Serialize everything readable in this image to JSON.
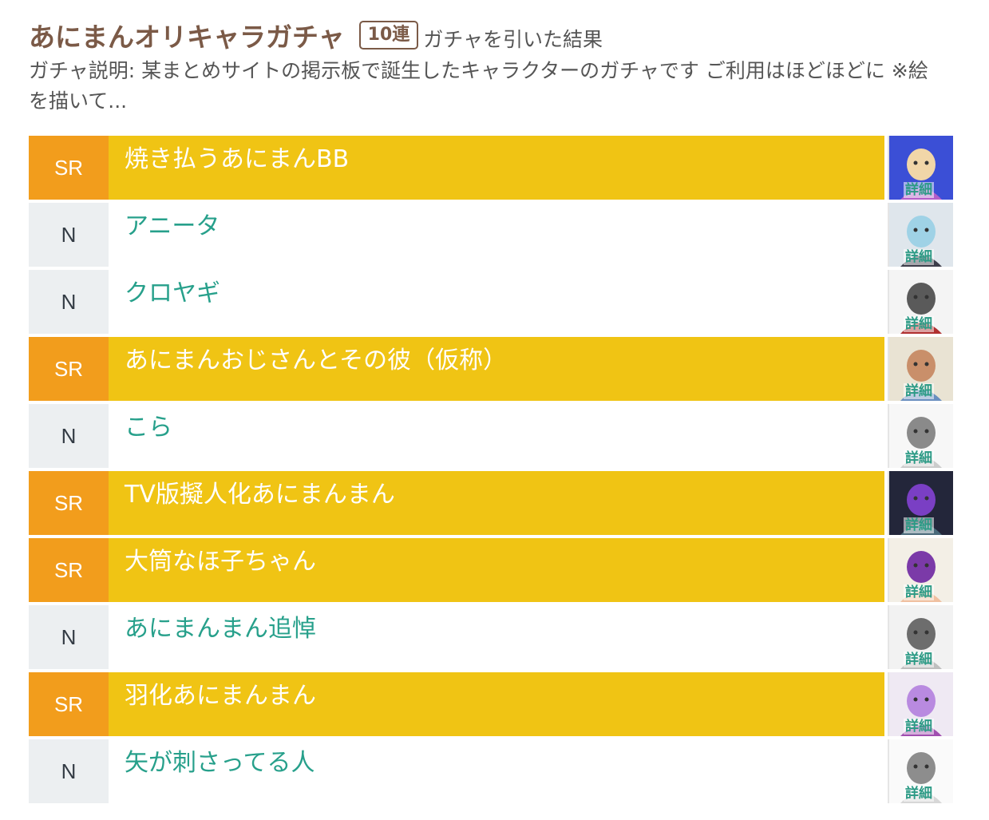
{
  "header": {
    "title": "あにまんオリキャラガチャ",
    "count_badge": "10連",
    "result_label": "ガチャを引いた結果",
    "description": "ガチャ説明: 某まとめサイトの掲示板で誕生したキャラクターのガチャです ご利用はほどほどに ※絵を描いて..."
  },
  "detail_label": "詳細",
  "colors": {
    "title": "#7b5a47",
    "sr_rarity_bg": "#f29d1c",
    "sr_row_bg": "#f0c414",
    "n_rarity_bg": "#eceff1",
    "n_name_text": "#27a08b"
  },
  "results": [
    {
      "rarity": "SR",
      "name": "焼き払うあにまんBB",
      "thumb_icon": "character-thumbnail-icon"
    },
    {
      "rarity": "N",
      "name": "アニータ",
      "thumb_icon": "character-thumbnail-icon"
    },
    {
      "rarity": "N",
      "name": "クロヤギ",
      "thumb_icon": "character-thumbnail-icon"
    },
    {
      "rarity": "SR",
      "name": "あにまんおじさんとその彼（仮称）",
      "thumb_icon": "character-thumbnail-icon"
    },
    {
      "rarity": "N",
      "name": "こら",
      "thumb_icon": "character-thumbnail-icon"
    },
    {
      "rarity": "SR",
      "name": "TV版擬人化あにまんまん",
      "thumb_icon": "character-thumbnail-icon"
    },
    {
      "rarity": "SR",
      "name": "大筒なほ子ちゃん",
      "thumb_icon": "character-thumbnail-icon"
    },
    {
      "rarity": "N",
      "name": "あにまんまん追悼",
      "thumb_icon": "character-thumbnail-icon"
    },
    {
      "rarity": "SR",
      "name": "羽化あにまんまん",
      "thumb_icon": "character-thumbnail-icon"
    },
    {
      "rarity": "N",
      "name": "矢が刺さってる人",
      "thumb_icon": "character-thumbnail-icon"
    }
  ]
}
